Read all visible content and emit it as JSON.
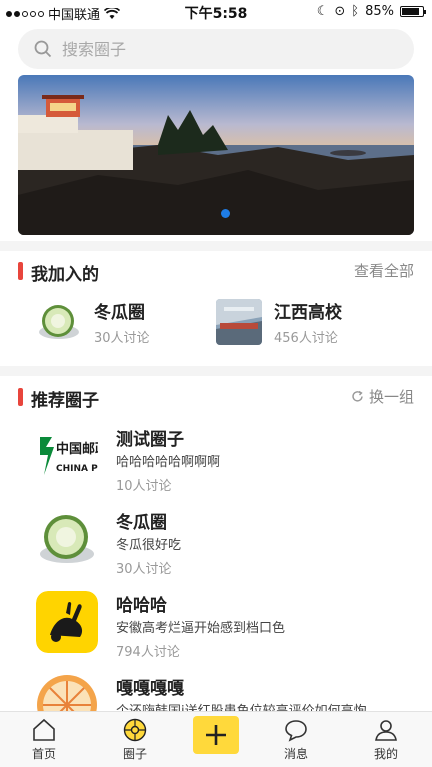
{
  "status_bar": {
    "carrier": "中国联通",
    "time": "下午5:58",
    "battery": "85%",
    "battery_level": 0.85
  },
  "search": {
    "placeholder": "搜索圈子",
    "icon": "search-icon"
  },
  "banner": {
    "page_indicator": {
      "count": 1,
      "active": 0
    }
  },
  "joined": {
    "title": "我加入的",
    "view_all": "查看全部",
    "items": [
      {
        "name": "冬瓜圈",
        "count": "30人讨论",
        "icon": "winter-melon-image"
      },
      {
        "name": "江西高校",
        "count": "456人讨论",
        "icon": "station-image"
      }
    ]
  },
  "recommended": {
    "title": "推荐圈子",
    "refresh": "换一组",
    "refresh_icon": "refresh-icon",
    "items": [
      {
        "name": "测试圈子",
        "desc": "哈哈哈哈哈啊啊啊",
        "count": "10人讨论",
        "icon": "china-post-logo"
      },
      {
        "name": "冬瓜圈",
        "desc": "冬瓜很好吃",
        "count": "30人讨论",
        "icon": "winter-melon-image"
      },
      {
        "name": "哈哈哈",
        "desc": "安徽高考烂逼开始感到档口色",
        "count": "794人讨论",
        "icon": "rabbit-app-icon"
      },
      {
        "name": "嘎嘎嘎嘎",
        "desc": "个还嗨韩国i送红股患鱼位较高评价如何高恂",
        "count": "",
        "icon": "wheel-image"
      }
    ]
  },
  "tabbar": {
    "items": [
      {
        "label": "首页",
        "icon": "home-icon"
      },
      {
        "label": "圈子",
        "icon": "circle-icon",
        "active": true
      },
      {
        "label": "",
        "icon": "plus-icon"
      },
      {
        "label": "消息",
        "icon": "chat-icon"
      },
      {
        "label": "我的",
        "icon": "profile-icon"
      }
    ]
  },
  "colors": {
    "accent_red": "#e8453c",
    "accent_yellow": "#ffd93b",
    "banner_dot": "#1e7de6"
  }
}
